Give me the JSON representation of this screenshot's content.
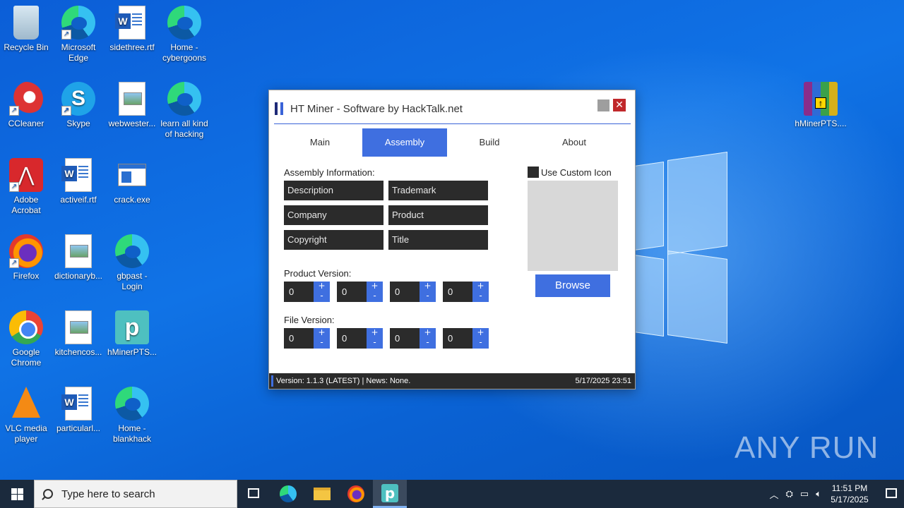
{
  "desktop": {
    "icons": [
      {
        "label": "Recycle Bin"
      },
      {
        "label": "Microsoft Edge"
      },
      {
        "label": "sidethree.rtf"
      },
      {
        "label": "Home - cybergoons"
      },
      {
        "label": "CCleaner"
      },
      {
        "label": "Skype"
      },
      {
        "label": "webwester..."
      },
      {
        "label": "learn all kind of hacking"
      },
      {
        "label": "Adobe Acrobat"
      },
      {
        "label": "activeif.rtf"
      },
      {
        "label": "crack.exe"
      },
      {
        "label": "Firefox"
      },
      {
        "label": "dictionaryb..."
      },
      {
        "label": "gbpast - Login"
      },
      {
        "label": "Google Chrome"
      },
      {
        "label": "kitchencos..."
      },
      {
        "label": "hMinerPTS..."
      },
      {
        "label": "VLC media player"
      },
      {
        "label": "particularl..."
      },
      {
        "label": "Home - blankhack"
      },
      {
        "label": "hMinerPTS...."
      }
    ],
    "watermark": "ANY RUN"
  },
  "window": {
    "title": "HT Miner - Software by HackTalk.net",
    "close_glyph": "✕",
    "tabs": [
      {
        "label": "Main"
      },
      {
        "label": "Assembly",
        "active": true
      },
      {
        "label": "Build"
      },
      {
        "label": "About"
      }
    ],
    "assembly_label": "Assembly Information:",
    "fields": {
      "description": "Description",
      "trademark": "Trademark",
      "company": "Company",
      "product": "Product",
      "copyright": "Copyright",
      "title": "Title"
    },
    "product_version_label": "Product Version:",
    "product_version": [
      "0",
      "0",
      "0",
      "0"
    ],
    "file_version_label": "File Version:",
    "file_version": [
      "0",
      "0",
      "0",
      "0"
    ],
    "plus": "+",
    "minus": "-",
    "use_custom_icon": "Use Custom Icon",
    "browse": "Browse",
    "status_left": "Version: 1.1.3 (LATEST) | News: None.",
    "status_right": "5/17/2025 23:51"
  },
  "taskbar": {
    "search_placeholder": "Type here to search",
    "time": "11:51 PM",
    "date": "5/17/2025"
  },
  "colors": {
    "accent": "#3f6fe0",
    "dark_field": "#2b2b2b",
    "close_red": "#c0282b",
    "taskbar": "#1b2a3d"
  }
}
